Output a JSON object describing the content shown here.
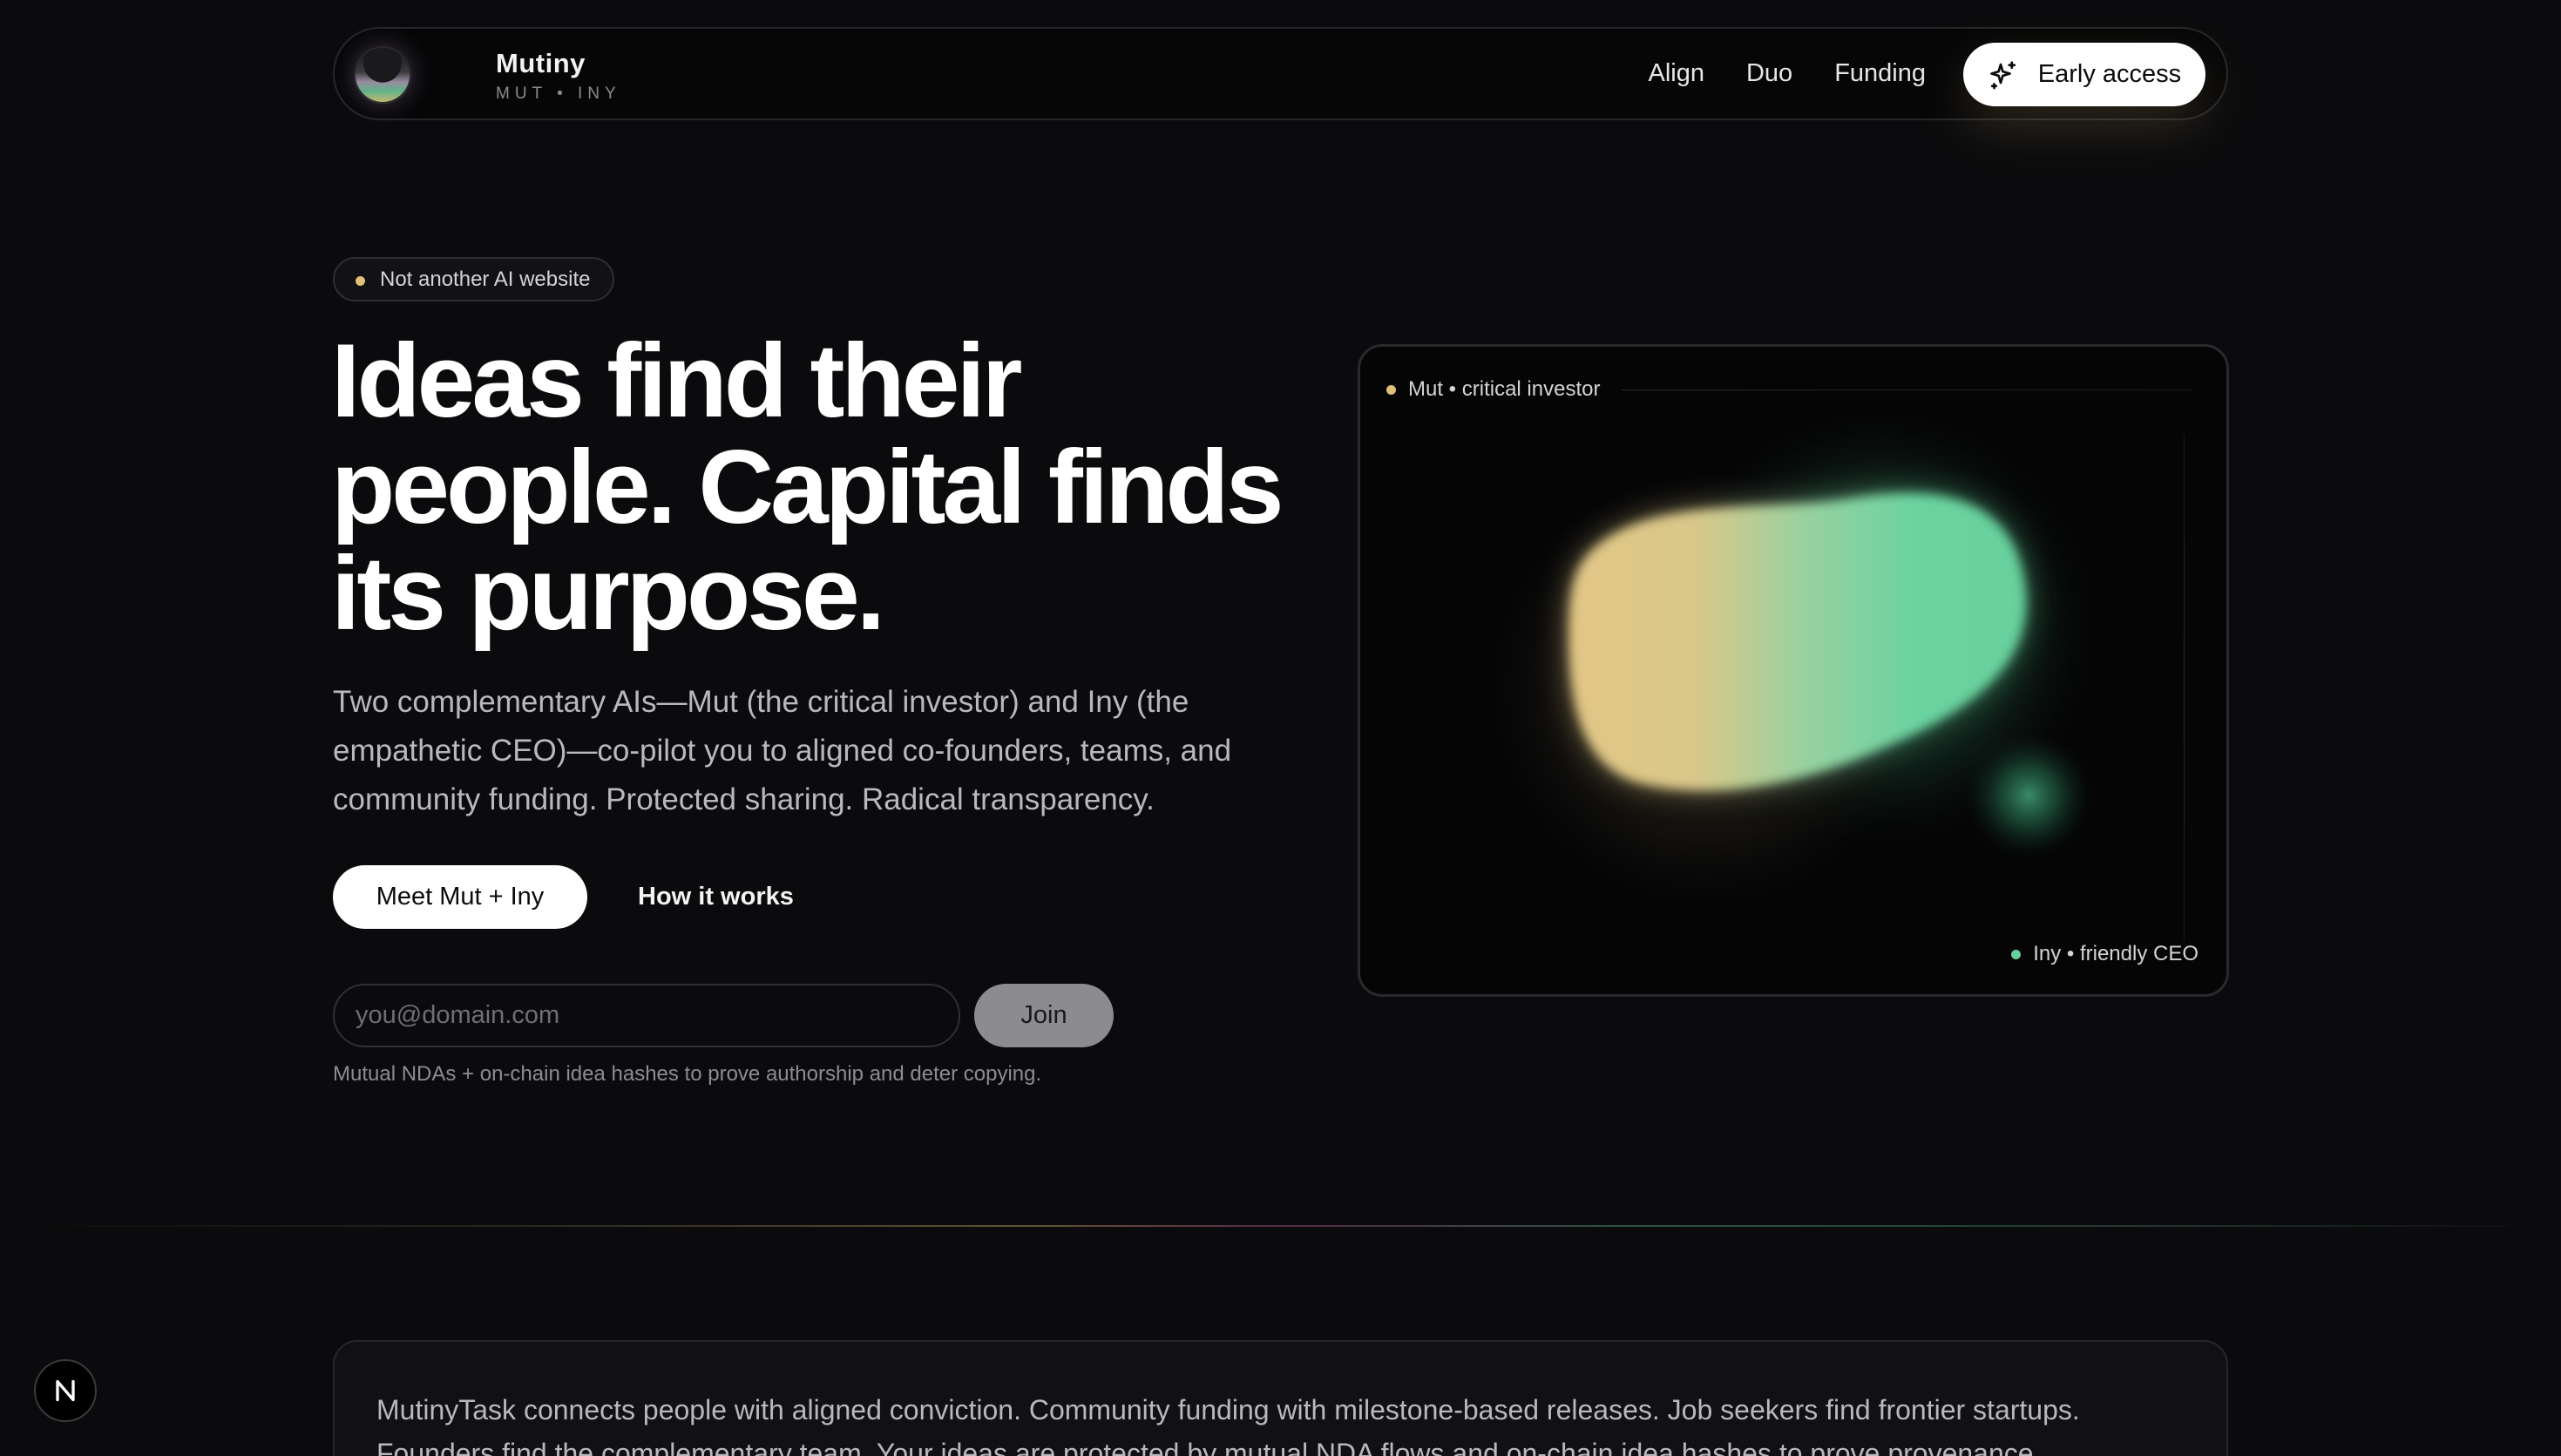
{
  "nav": {
    "brand_name": "Mutiny",
    "brand_sub": "MUT • INY",
    "links": [
      "Align",
      "Duo",
      "Funding"
    ],
    "cta_label": "Early access",
    "cta_icon": "sparkles-icon"
  },
  "hero": {
    "pill_text": "Not another AI website",
    "headline_lines": [
      "Ideas find their",
      "people. Capital finds",
      "its purpose."
    ],
    "subcopy": "Two complementary AIs—Mut (the critical investor) and Iny (the empathetic CEO)—co-pilot you to aligned co-founders, teams, and community funding. Protected sharing. Radical transparency.",
    "primary_cta": "Meet Mut + Iny",
    "secondary_cta": "How it works",
    "email_placeholder": "you@domain.com",
    "email_value": "",
    "join_label": "Join",
    "finenote": "Mutual NDAs + on-chain idea hashes to prove authorship and deter copying."
  },
  "card": {
    "label_mut": "Mut • critical investor",
    "label_iny": "Iny • friendly CEO"
  },
  "panel": {
    "text": "MutinyTask connects people with aligned conviction. Community funding with milestone-based releases. Job seekers find frontier startups. Founders find the complementary team. Your ideas are protected by mutual NDA flows and on-chain idea hashes to prove provenance."
  },
  "badge": {
    "letter_icon": "n-logo-icon"
  },
  "colors": {
    "background": "#0b0b0d",
    "mut_gold": "#e0bf7b",
    "iny_green": "#67cf9c",
    "button_white": "#ffffff",
    "join_gray": "#8c8c8e"
  }
}
